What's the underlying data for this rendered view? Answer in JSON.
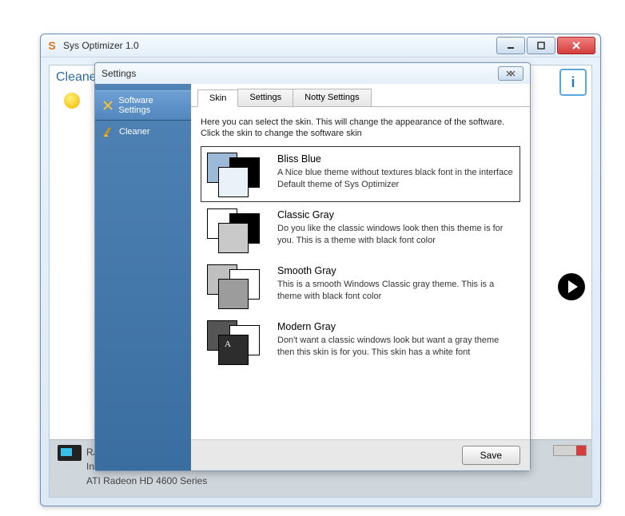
{
  "window": {
    "title": "Sys Optimizer 1.0",
    "gpu_label": "ATI Radeon HD 4600 Series",
    "gpu_line1": "RA",
    "gpu_line2": "In",
    "back_section": "Cleane"
  },
  "dialog": {
    "title": "Settings",
    "sidebar": [
      {
        "label": "Software Settings"
      },
      {
        "label": "Cleaner"
      }
    ],
    "tabs": [
      {
        "label": "Skin"
      },
      {
        "label": "Settings"
      },
      {
        "label": "Notty Settings"
      }
    ],
    "skin_desc": "Here you can select the skin. This will change the appearance of the software. Click the skin to change the software skin",
    "skins": [
      {
        "name": "Bliss Blue",
        "desc": "A Nice blue theme without textures black font in the interface Default theme of Sys Optimizer",
        "colors": [
          "#9cb9d8",
          "#000000",
          "#eaf1f9"
        ],
        "selected": true
      },
      {
        "name": "Classic Gray",
        "desc": "Do you like the classic windows look then this theme is for you. This is a theme with black font color",
        "colors": [
          "#ffffff",
          "#000000",
          "#c9c9c9"
        ]
      },
      {
        "name": "Smooth Gray",
        "desc": "This is a smooth Windows Classic gray theme. This is a theme with black font color",
        "colors": [
          "#bfbfbf",
          "#ffffff",
          "#9c9c9c"
        ]
      },
      {
        "name": "Modern Gray",
        "desc": "Don't want a classic windows look but want a gray theme then this skin is for you. This skin has a white font",
        "colors": [
          "#555555",
          "#ffffff",
          "#2d2d2d"
        ],
        "letter": "A"
      }
    ],
    "save_label": "Save"
  }
}
